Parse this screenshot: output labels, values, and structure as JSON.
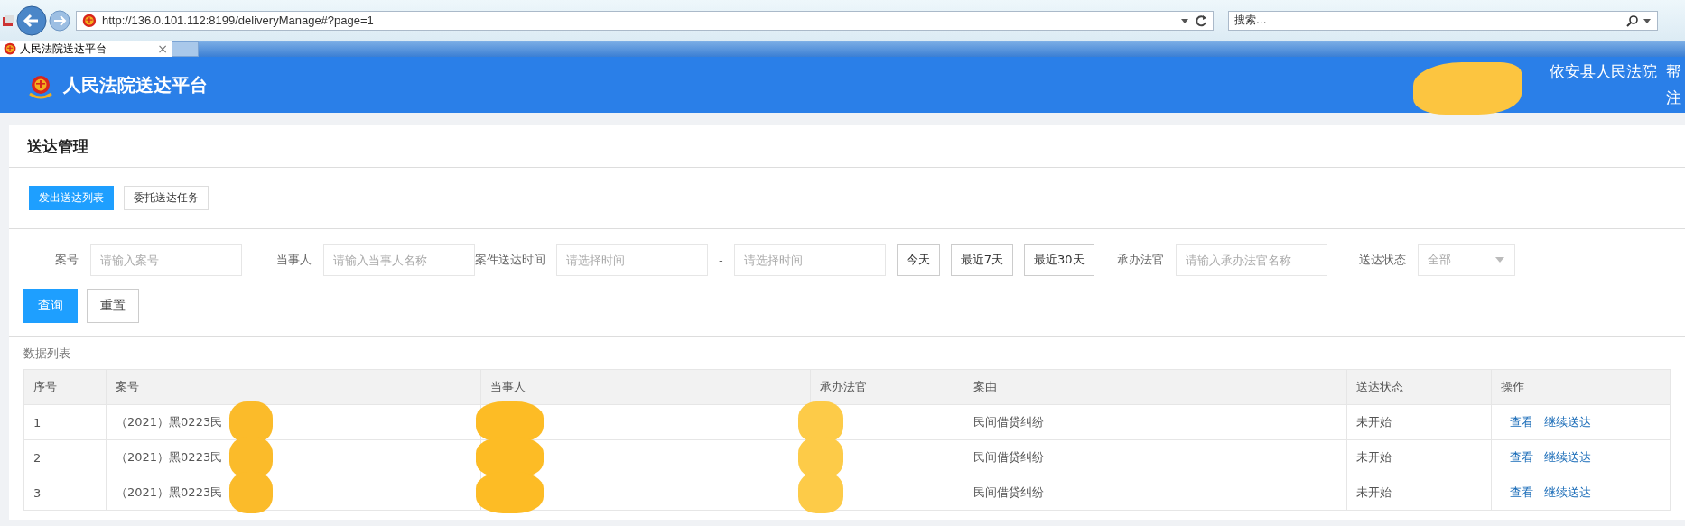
{
  "browser": {
    "url": "http://136.0.101.112:8199/deliveryManage#?page=1",
    "search_placeholder": "搜索...",
    "tab": {
      "title": "人民法院送达平台",
      "close": "×"
    }
  },
  "header": {
    "title": "人民法院送达平台",
    "user_redacted": true,
    "court": "依安县人民法院",
    "help": "帮",
    "logout": "注"
  },
  "page": {
    "title": "送达管理",
    "tabs": [
      {
        "label": "发出送达列表",
        "selected": true
      },
      {
        "label": "委托送达任务",
        "selected": false
      }
    ],
    "filters": [
      {
        "kind": "input",
        "label": "案号",
        "placeholder": "请输入案号"
      },
      {
        "kind": "input",
        "label": "当事人",
        "placeholder": "请输入当事人名称"
      },
      {
        "kind": "range",
        "label": "案件送达时间",
        "placeholder": "请选择时间",
        "separator": "-",
        "placeholder_end": "请选择时间",
        "quick": [
          "今天",
          "最近7天",
          "最近30天"
        ]
      },
      {
        "kind": "input",
        "label": "承办法官",
        "placeholder": "请输入承办法官名称"
      },
      {
        "kind": "select",
        "label": "送达状态",
        "value": "全部"
      }
    ],
    "actions": [
      {
        "label": "查询",
        "primary": true
      },
      {
        "label": "重置",
        "primary": false
      }
    ],
    "list_title": "数据列表",
    "table": {
      "columns": [
        "序号",
        "案号",
        "当事人",
        "承办法官",
        "案由",
        "送达状态",
        "操作"
      ],
      "rows": [
        {
          "index": "1",
          "case_no": "（2021）黑0223民",
          "case_no_redacted": true,
          "party_redacted": true,
          "judge_redacted": true,
          "cause": "民间借贷纠纷",
          "status": "未开始",
          "links": [
            "查看",
            "继续送达"
          ]
        },
        {
          "index": "2",
          "case_no": "（2021）黑0223民",
          "case_no_redacted": true,
          "party_redacted": true,
          "judge_redacted": true,
          "cause": "民间借贷纠纷",
          "status": "未开始",
          "links": [
            "查看",
            "继续送达"
          ]
        },
        {
          "index": "3",
          "case_no": "（2021）黑0223民",
          "case_no_redacted": true,
          "party_redacted": true,
          "judge_redacted": true,
          "cause": "民间借贷纠纷",
          "status": "未开始",
          "links": [
            "查看",
            "继续送达"
          ]
        }
      ]
    }
  }
}
